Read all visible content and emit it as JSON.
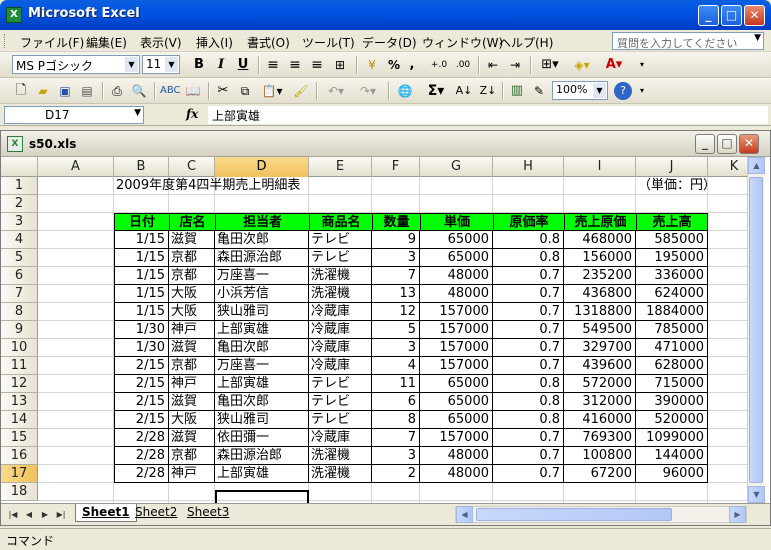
{
  "window": {
    "title": "Microsoft Excel"
  },
  "menu": {
    "items": [
      "ファイル(F)",
      "編集(E)",
      "表示(V)",
      "挿入(I)",
      "書式(O)",
      "ツール(T)",
      "データ(D)",
      "ウィンドウ(W)",
      "ヘルプ(H)"
    ],
    "help_placeholder": "質問を入力してください"
  },
  "toolbar": {
    "font_name": "MS Pゴシック",
    "font_size": "11",
    "zoom": "100%",
    "bold": "B",
    "italic": "I",
    "underline": "U",
    "percent": "%",
    "comma": ","
  },
  "formula_bar": {
    "name_box": "D17",
    "fx": "fx",
    "content": "上部寅雄"
  },
  "workbook": {
    "filename": "s50.xls"
  },
  "sheet": {
    "columns": [
      "A",
      "B",
      "C",
      "D",
      "E",
      "F",
      "G",
      "H",
      "I",
      "J",
      "K"
    ],
    "rows": [
      "1",
      "2",
      "3",
      "4",
      "5",
      "6",
      "7",
      "8",
      "9",
      "10",
      "11",
      "12",
      "13",
      "14",
      "15",
      "16",
      "17",
      "18"
    ],
    "title": "2009年度第4四半期売上明細表",
    "unit": "（単価：円）",
    "headers": [
      "日付",
      "店名",
      "担当者",
      "商品名",
      "数量",
      "単価",
      "原価率",
      "売上原価",
      "売上高"
    ],
    "data": [
      [
        "1/15",
        "滋賀",
        "亀田次郎",
        "テレビ",
        "9",
        "65000",
        "0.8",
        "468000",
        "585000"
      ],
      [
        "1/15",
        "京都",
        "森田源治郎",
        "テレビ",
        "3",
        "65000",
        "0.8",
        "156000",
        "195000"
      ],
      [
        "1/15",
        "京都",
        "万座喜一",
        "洗濯機",
        "7",
        "48000",
        "0.7",
        "235200",
        "336000"
      ],
      [
        "1/15",
        "大阪",
        "小浜芳信",
        "洗濯機",
        "13",
        "48000",
        "0.7",
        "436800",
        "624000"
      ],
      [
        "1/15",
        "大阪",
        "狭山雅司",
        "冷蔵庫",
        "12",
        "157000",
        "0.7",
        "1318800",
        "1884000"
      ],
      [
        "1/30",
        "神戸",
        "上部寅雄",
        "冷蔵庫",
        "5",
        "157000",
        "0.7",
        "549500",
        "785000"
      ],
      [
        "1/30",
        "滋賀",
        "亀田次郎",
        "冷蔵庫",
        "3",
        "157000",
        "0.7",
        "329700",
        "471000"
      ],
      [
        "2/15",
        "京都",
        "万座喜一",
        "冷蔵庫",
        "4",
        "157000",
        "0.7",
        "439600",
        "628000"
      ],
      [
        "2/15",
        "神戸",
        "上部寅雄",
        "テレビ",
        "11",
        "65000",
        "0.8",
        "572000",
        "715000"
      ],
      [
        "2/15",
        "滋賀",
        "亀田次郎",
        "テレビ",
        "6",
        "65000",
        "0.8",
        "312000",
        "390000"
      ],
      [
        "2/15",
        "大阪",
        "狭山雅司",
        "テレビ",
        "8",
        "65000",
        "0.8",
        "416000",
        "520000"
      ],
      [
        "2/28",
        "滋賀",
        "依田彌一",
        "冷蔵庫",
        "7",
        "157000",
        "0.7",
        "769300",
        "1099000"
      ],
      [
        "2/28",
        "京都",
        "森田源治郎",
        "洗濯機",
        "3",
        "48000",
        "0.7",
        "100800",
        "144000"
      ],
      [
        "2/28",
        "神戸",
        "上部寅雄",
        "洗濯機",
        "2",
        "48000",
        "0.7",
        "67200",
        "96000"
      ]
    ]
  },
  "tabs": [
    "Sheet1",
    "Sheet2",
    "Sheet3"
  ],
  "status": "コマンド",
  "colors": {
    "header_fill": "#00ff00",
    "selection": "#f1c15c",
    "titlebar": "#0054e3"
  }
}
